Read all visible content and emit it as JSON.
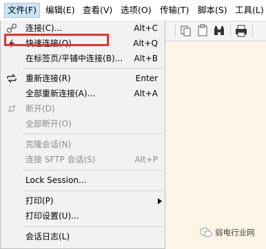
{
  "menubar": {
    "items": [
      {
        "label": "文件(F)",
        "active": true
      },
      {
        "label": "编辑(E)"
      },
      {
        "label": "查看(V)"
      },
      {
        "label": "选项(O)"
      },
      {
        "label": "传输(T)"
      },
      {
        "label": "脚本(S)"
      },
      {
        "label": "工具(L)"
      }
    ]
  },
  "file_menu": {
    "items": [
      {
        "label": "连接(C)...",
        "shortcut": "Alt+C",
        "icon": "link-icon",
        "enabled": true
      },
      {
        "label": "快速连接(Q)...",
        "shortcut": "Alt+Q",
        "icon": "lightning-icon",
        "enabled": true,
        "highlighted": true
      },
      {
        "label": "在标签页/平铺中连接(B)...",
        "shortcut": "Alt+B",
        "enabled": true
      },
      {
        "label": "重新连接(R)",
        "shortcut": "Enter",
        "icon": "reconnect-icon",
        "enabled": true
      },
      {
        "label": "全部重新连接(A)...",
        "shortcut": "Alt+A",
        "enabled": true
      },
      {
        "label": "断开(D)",
        "shortcut": "",
        "enabled": false
      },
      {
        "label": "全部断开(O)",
        "shortcut": "",
        "enabled": false
      },
      {
        "label": "克隆会话(N)",
        "shortcut": "",
        "enabled": false
      },
      {
        "label": "连接 SFTP 会话(S)",
        "shortcut": "Alt+P",
        "enabled": false
      },
      {
        "label": "Lock Session...",
        "shortcut": "",
        "enabled": true
      },
      {
        "label": "打印(P)",
        "shortcut": "",
        "enabled": true,
        "submenu": true
      },
      {
        "label": "打印设置(U)...",
        "shortcut": "",
        "enabled": true
      },
      {
        "label": "会话日志(L)",
        "shortcut": "",
        "enabled": true
      }
    ]
  },
  "watermark": {
    "text": "弱电行业网"
  },
  "colors": {
    "highlight": "#e8302d",
    "session_bg": "#fdf5e6",
    "menu_bg": "#f2f2f2"
  }
}
